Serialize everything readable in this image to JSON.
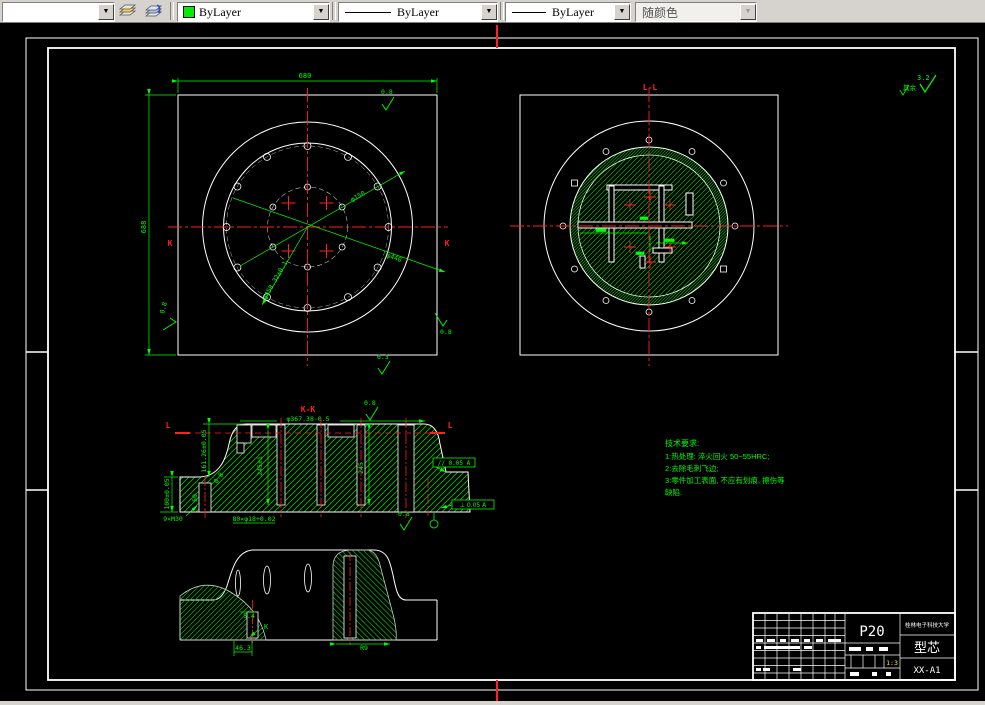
{
  "toolbar": {
    "color": {
      "value": "ByLayer",
      "swatch_color": "#00ee00"
    },
    "linetype": {
      "value": "ByLayer"
    },
    "lineweight": {
      "value": "ByLayer"
    },
    "plotstyle": {
      "value": "随颜色"
    }
  },
  "colors": {
    "outline": "#ffffff",
    "dimension": "#00ff00",
    "hatch": "#00c800",
    "centerline": "#ff0000"
  },
  "drawing": {
    "general_finish": {
      "prefix": "其余",
      "value": "3.2"
    },
    "plan_view": {
      "dim_width": "680",
      "dim_height": "688",
      "dim_c1": "φ150",
      "dim_c2": "φ440",
      "dim_c3": "φ458.32±0.1",
      "label_k": "K",
      "finish_1": "0.8",
      "finish_2": "0.8",
      "finish_3": "0.8",
      "finish_4": "6.3"
    },
    "section_ll": {
      "title": "L-L"
    },
    "section_kk": {
      "title": "K-K",
      "dim_dia": "φ367.38-0.5",
      "dim_h1": "161.26±0.05",
      "dim_h2": "100±0.05",
      "dim_thread": "9×M30",
      "dim_boss": "50",
      "dim_h3": "245±1",
      "dim_h4": "245",
      "dim_holes": "80×φ18+0.02",
      "finish_top": "0.8",
      "finish_fillet": "0.8",
      "finish_bottom": "0.8",
      "tol_parallel": "// 0.05 A",
      "tol_perp": "⊥ 0.05 A",
      "label_l": "L"
    },
    "detail_view": {
      "dim_1": "46.3",
      "dim_2": "5.4",
      "dim_3": "R9",
      "label_k": "K"
    },
    "notes": {
      "title": "技术要求:",
      "lines": [
        "1:热处理: 淬火回火 50~55HRC;",
        "2:去除毛刺飞边;",
        "3:零件加工表面, 不应有划痕, 擦伤等",
        "缺陷."
      ]
    },
    "title_block": {
      "material": "P20",
      "company": "桂林电子科技大学",
      "part_name": "型芯",
      "drawing_no": "XX-A1",
      "scale": "1:3"
    }
  }
}
